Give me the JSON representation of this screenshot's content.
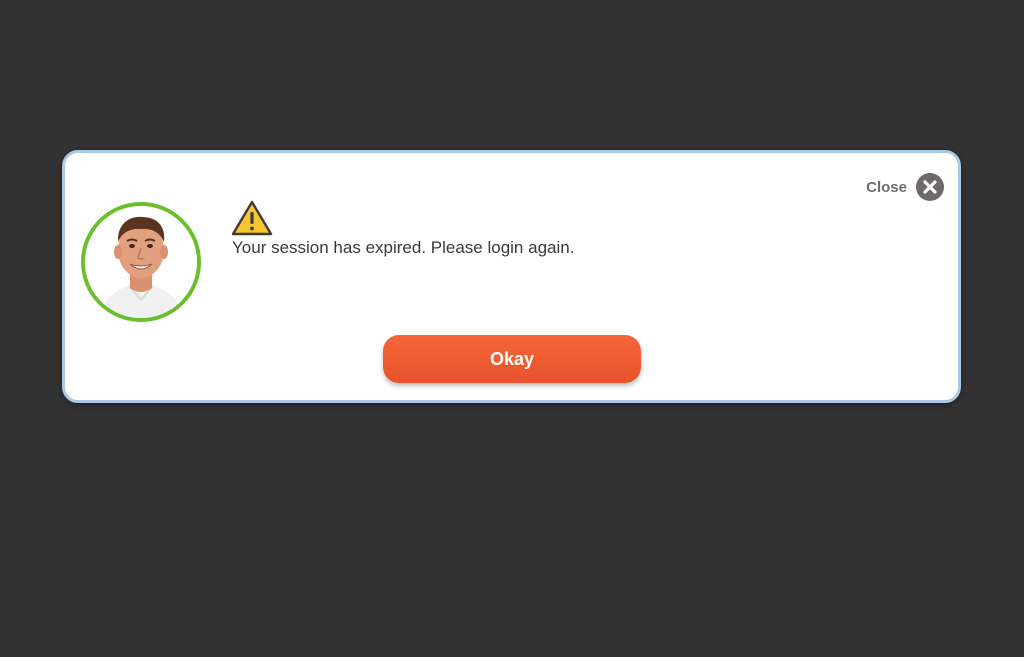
{
  "dialog": {
    "close_label": "Close",
    "message": "Your session has expired. Please login again.",
    "okay_label": "Okay"
  },
  "icons": {
    "close": "close-icon",
    "warning": "warning-icon",
    "avatar": "avatar"
  },
  "colors": {
    "backdrop": "#323232",
    "dialog_border": "#a9c9e6",
    "avatar_ring": "#6bbf2e",
    "button": "#ee5a2f",
    "warning_fill": "#f7c531",
    "close_icon": "#6e6a6a"
  }
}
